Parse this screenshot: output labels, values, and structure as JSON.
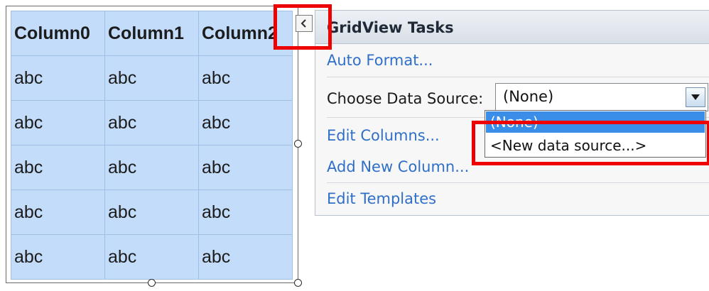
{
  "gridview": {
    "columns": [
      "Column0",
      "Column1",
      "Column2"
    ],
    "rows": [
      [
        "abc",
        "abc",
        "abc"
      ],
      [
        "abc",
        "abc",
        "abc"
      ],
      [
        "abc",
        "abc",
        "abc"
      ],
      [
        "abc",
        "abc",
        "abc"
      ],
      [
        "abc",
        "abc",
        "abc"
      ]
    ]
  },
  "smart_tag": {
    "icon": "collapse-arrow-icon"
  },
  "tasks_panel": {
    "title": "GridView Tasks",
    "auto_format": "Auto Format...",
    "choose_data_source_label": "Choose Data Source:",
    "data_source_value": "(None)",
    "data_source_options": [
      "(None)",
      "<New data source...>"
    ],
    "selected_option_index": 0,
    "edit_columns": "Edit Columns...",
    "add_new_column": "Add New Column...",
    "edit_templates": "Edit Templates"
  },
  "colors": {
    "grid_fill": "#c2dcfa",
    "link": "#2f6fc7",
    "selection": "#3b8ee8",
    "annotation": "#ee0000"
  }
}
